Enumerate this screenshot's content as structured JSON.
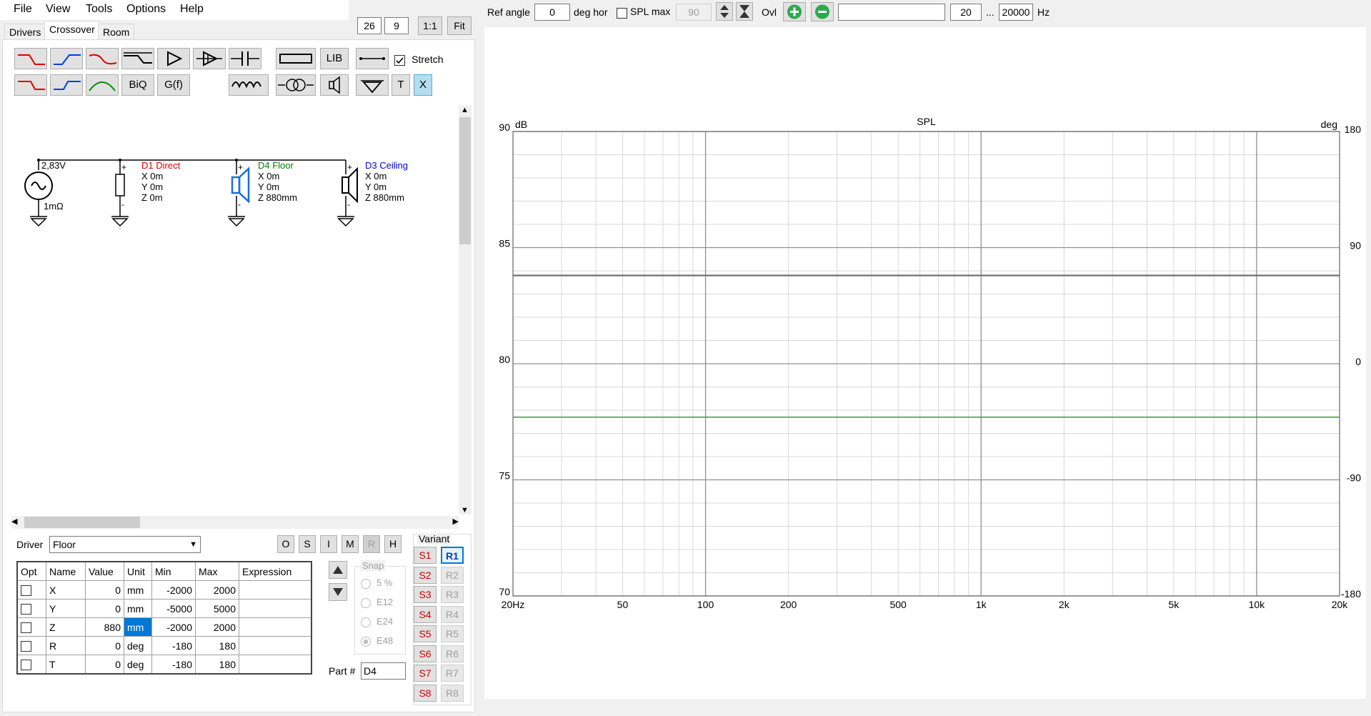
{
  "menu": [
    "File",
    "View",
    "Tools",
    "Options",
    "Help"
  ],
  "grid_inputs": {
    "cols": "26",
    "rows": "9",
    "btn_1to1": "1:1",
    "btn_fit": "Fit"
  },
  "tabs": [
    {
      "label": "Drivers"
    },
    {
      "label": "Crossover",
      "active": true
    },
    {
      "label": "Room"
    }
  ],
  "toolbar": {
    "lib": "LIB",
    "biq": "BiQ",
    "gf": "G(f)",
    "t": "T",
    "x": "X",
    "stretch_label": "Stretch",
    "stretch_checked": true
  },
  "schematic": {
    "source_voltage": "2,83V",
    "source_impedance": "1mΩ",
    "drivers": [
      {
        "name": "D1 Direct",
        "color": "#e00000",
        "x": "X 0m",
        "y": "Y 0m",
        "z": "Z 0m"
      },
      {
        "name": "D4 Floor",
        "color": "#008000",
        "x": "X 0m",
        "y": "Y 0m",
        "z": "Z 880mm"
      },
      {
        "name": "D3 Ceiling",
        "color": "#0000e0",
        "x": "X 0m",
        "y": "Y 0m",
        "z": "Z 880mm"
      }
    ]
  },
  "driver_select": {
    "label": "Driver",
    "value": "Floor"
  },
  "mode_buttons": [
    "O",
    "S",
    "I",
    "M",
    "R",
    "H"
  ],
  "params": {
    "headers": [
      "Opt",
      "Name",
      "Value",
      "Unit",
      "Min",
      "Max",
      "Expression"
    ],
    "rows": [
      {
        "name": "X",
        "value": "0",
        "unit": "mm",
        "min": "-2000",
        "max": "2000"
      },
      {
        "name": "Y",
        "value": "0",
        "unit": "mm",
        "min": "-5000",
        "max": "5000"
      },
      {
        "name": "Z",
        "value": "880",
        "unit": "mm",
        "min": "-2000",
        "max": "2000"
      },
      {
        "name": "R",
        "value": "0",
        "unit": "deg",
        "min": "-180",
        "max": "180"
      },
      {
        "name": "T",
        "value": "0",
        "unit": "deg",
        "min": "-180",
        "max": "180"
      }
    ]
  },
  "snap": {
    "label": "Snap",
    "options": [
      "5 %",
      "E12",
      "E24",
      "E48"
    ],
    "selected": "E48"
  },
  "part": {
    "label": "Part #",
    "value": "D4"
  },
  "variant": {
    "label": "Variant",
    "s": [
      "S1",
      "S2",
      "S3",
      "S4",
      "S5",
      "S6",
      "S7",
      "S8"
    ],
    "r": [
      "R1",
      "R2",
      "R3",
      "R4",
      "R5",
      "R6",
      "R7",
      "R8"
    ],
    "active": "R1"
  },
  "top_controls": {
    "ref_angle_label": "Ref angle",
    "ref_angle": "0",
    "deg_hor": "deg hor",
    "spl_max_label": "SPL max",
    "spl_max": "90",
    "ovl_label": "Ovl",
    "freq_min": "20",
    "ellipsis": "...",
    "freq_max": "20000",
    "hz": "Hz"
  },
  "chart_data": {
    "type": "line",
    "title": "SPL",
    "ylabel_left": "dB",
    "ylabel_right": "deg",
    "x_scale": "log",
    "xlim": [
      20,
      20000
    ],
    "x_ticks": [
      {
        "v": 20,
        "label": "20Hz"
      },
      {
        "v": 50,
        "label": "50"
      },
      {
        "v": 100,
        "label": "100"
      },
      {
        "v": 200,
        "label": "200"
      },
      {
        "v": 500,
        "label": "500"
      },
      {
        "v": 1000,
        "label": "1k"
      },
      {
        "v": 2000,
        "label": "2k"
      },
      {
        "v": 5000,
        "label": "5k"
      },
      {
        "v": 10000,
        "label": "10k"
      },
      {
        "v": 20000,
        "label": "20k"
      }
    ],
    "ylim_left": [
      70,
      90
    ],
    "y_ticks_left": [
      "70",
      "75",
      "80",
      "85",
      "90"
    ],
    "ylim_right": [
      -180,
      180
    ],
    "y_ticks_right": [
      "-180",
      "-90",
      "0",
      "90",
      "180"
    ],
    "grid": true,
    "series": [
      {
        "color": "#707070",
        "axis": "left",
        "x": [
          20,
          20000
        ],
        "y": [
          83.8,
          83.8
        ]
      },
      {
        "color": "#3a9a3a",
        "axis": "left",
        "x": [
          20,
          20000
        ],
        "y": [
          77.7,
          77.7
        ]
      }
    ]
  }
}
